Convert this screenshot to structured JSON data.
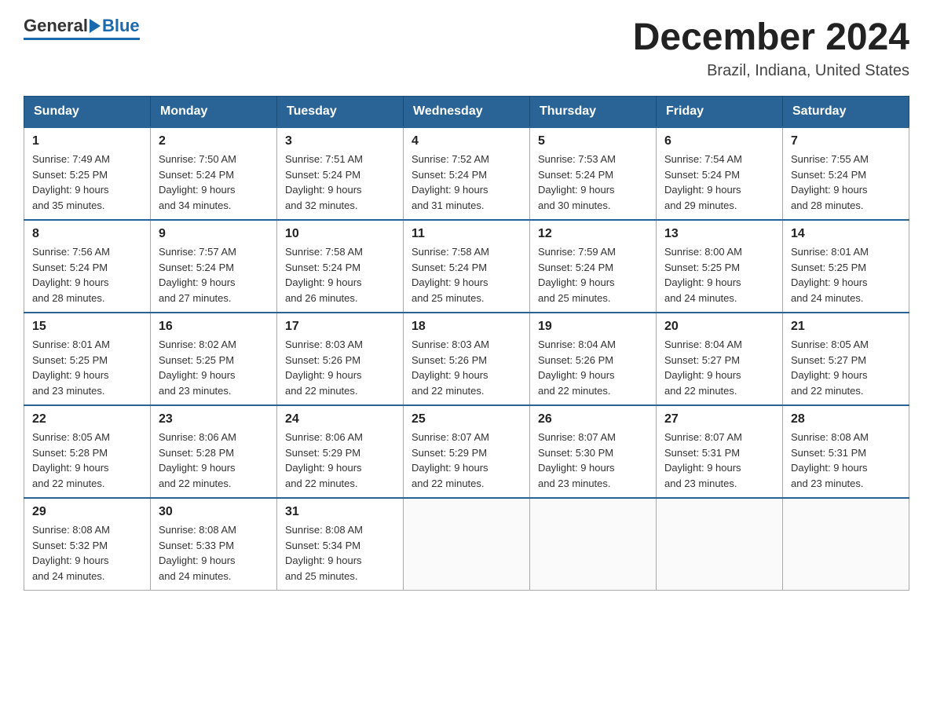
{
  "header": {
    "logo_general": "General",
    "logo_blue": "Blue",
    "month_title": "December 2024",
    "location": "Brazil, Indiana, United States"
  },
  "days_of_week": [
    "Sunday",
    "Monday",
    "Tuesday",
    "Wednesday",
    "Thursday",
    "Friday",
    "Saturday"
  ],
  "weeks": [
    [
      {
        "day": "1",
        "sunrise": "7:49 AM",
        "sunset": "5:25 PM",
        "daylight": "9 hours and 35 minutes."
      },
      {
        "day": "2",
        "sunrise": "7:50 AM",
        "sunset": "5:24 PM",
        "daylight": "9 hours and 34 minutes."
      },
      {
        "day": "3",
        "sunrise": "7:51 AM",
        "sunset": "5:24 PM",
        "daylight": "9 hours and 32 minutes."
      },
      {
        "day": "4",
        "sunrise": "7:52 AM",
        "sunset": "5:24 PM",
        "daylight": "9 hours and 31 minutes."
      },
      {
        "day": "5",
        "sunrise": "7:53 AM",
        "sunset": "5:24 PM",
        "daylight": "9 hours and 30 minutes."
      },
      {
        "day": "6",
        "sunrise": "7:54 AM",
        "sunset": "5:24 PM",
        "daylight": "9 hours and 29 minutes."
      },
      {
        "day": "7",
        "sunrise": "7:55 AM",
        "sunset": "5:24 PM",
        "daylight": "9 hours and 28 minutes."
      }
    ],
    [
      {
        "day": "8",
        "sunrise": "7:56 AM",
        "sunset": "5:24 PM",
        "daylight": "9 hours and 28 minutes."
      },
      {
        "day": "9",
        "sunrise": "7:57 AM",
        "sunset": "5:24 PM",
        "daylight": "9 hours and 27 minutes."
      },
      {
        "day": "10",
        "sunrise": "7:58 AM",
        "sunset": "5:24 PM",
        "daylight": "9 hours and 26 minutes."
      },
      {
        "day": "11",
        "sunrise": "7:58 AM",
        "sunset": "5:24 PM",
        "daylight": "9 hours and 25 minutes."
      },
      {
        "day": "12",
        "sunrise": "7:59 AM",
        "sunset": "5:24 PM",
        "daylight": "9 hours and 25 minutes."
      },
      {
        "day": "13",
        "sunrise": "8:00 AM",
        "sunset": "5:25 PM",
        "daylight": "9 hours and 24 minutes."
      },
      {
        "day": "14",
        "sunrise": "8:01 AM",
        "sunset": "5:25 PM",
        "daylight": "9 hours and 24 minutes."
      }
    ],
    [
      {
        "day": "15",
        "sunrise": "8:01 AM",
        "sunset": "5:25 PM",
        "daylight": "9 hours and 23 minutes."
      },
      {
        "day": "16",
        "sunrise": "8:02 AM",
        "sunset": "5:25 PM",
        "daylight": "9 hours and 23 minutes."
      },
      {
        "day": "17",
        "sunrise": "8:03 AM",
        "sunset": "5:26 PM",
        "daylight": "9 hours and 22 minutes."
      },
      {
        "day": "18",
        "sunrise": "8:03 AM",
        "sunset": "5:26 PM",
        "daylight": "9 hours and 22 minutes."
      },
      {
        "day": "19",
        "sunrise": "8:04 AM",
        "sunset": "5:26 PM",
        "daylight": "9 hours and 22 minutes."
      },
      {
        "day": "20",
        "sunrise": "8:04 AM",
        "sunset": "5:27 PM",
        "daylight": "9 hours and 22 minutes."
      },
      {
        "day": "21",
        "sunrise": "8:05 AM",
        "sunset": "5:27 PM",
        "daylight": "9 hours and 22 minutes."
      }
    ],
    [
      {
        "day": "22",
        "sunrise": "8:05 AM",
        "sunset": "5:28 PM",
        "daylight": "9 hours and 22 minutes."
      },
      {
        "day": "23",
        "sunrise": "8:06 AM",
        "sunset": "5:28 PM",
        "daylight": "9 hours and 22 minutes."
      },
      {
        "day": "24",
        "sunrise": "8:06 AM",
        "sunset": "5:29 PM",
        "daylight": "9 hours and 22 minutes."
      },
      {
        "day": "25",
        "sunrise": "8:07 AM",
        "sunset": "5:29 PM",
        "daylight": "9 hours and 22 minutes."
      },
      {
        "day": "26",
        "sunrise": "8:07 AM",
        "sunset": "5:30 PM",
        "daylight": "9 hours and 23 minutes."
      },
      {
        "day": "27",
        "sunrise": "8:07 AM",
        "sunset": "5:31 PM",
        "daylight": "9 hours and 23 minutes."
      },
      {
        "day": "28",
        "sunrise": "8:08 AM",
        "sunset": "5:31 PM",
        "daylight": "9 hours and 23 minutes."
      }
    ],
    [
      {
        "day": "29",
        "sunrise": "8:08 AM",
        "sunset": "5:32 PM",
        "daylight": "9 hours and 24 minutes."
      },
      {
        "day": "30",
        "sunrise": "8:08 AM",
        "sunset": "5:33 PM",
        "daylight": "9 hours and 24 minutes."
      },
      {
        "day": "31",
        "sunrise": "8:08 AM",
        "sunset": "5:34 PM",
        "daylight": "9 hours and 25 minutes."
      },
      null,
      null,
      null,
      null
    ]
  ],
  "labels": {
    "sunrise": "Sunrise:",
    "sunset": "Sunset:",
    "daylight": "Daylight:"
  }
}
